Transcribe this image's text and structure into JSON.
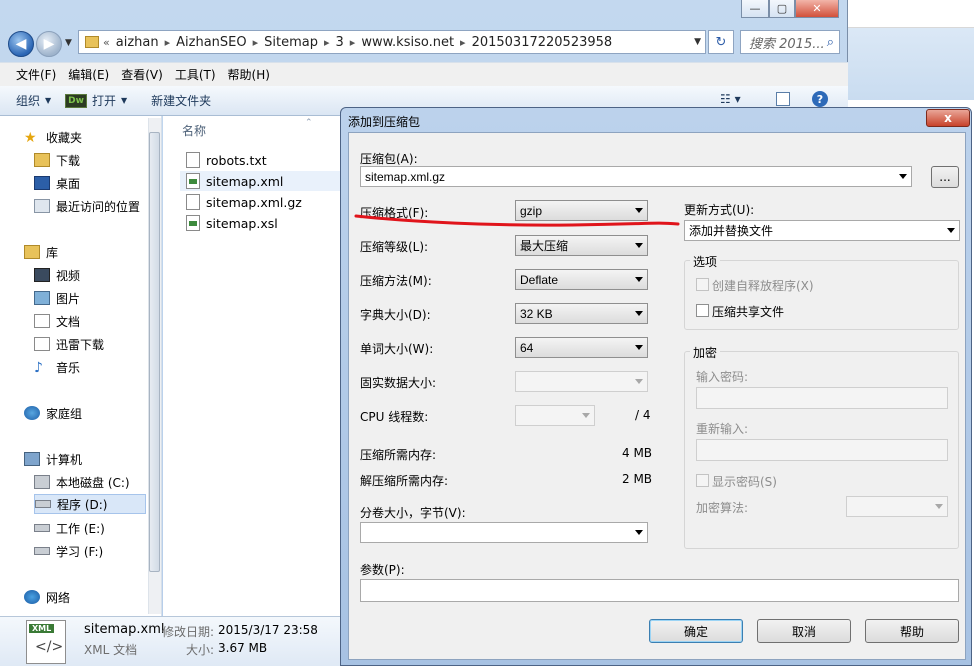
{
  "explorer": {
    "breadcrumbs": [
      "aizhan",
      "AizhanSEO",
      "Sitemap",
      "3",
      "www.ksiso.net",
      "20150317220523958"
    ],
    "search_placeholder": "搜索 2015...",
    "menu": [
      "文件(F)",
      "编辑(E)",
      "查看(V)",
      "工具(T)",
      "帮助(H)"
    ],
    "toolbar": {
      "organize": "组织",
      "open": "打开",
      "dw_badge": "Dw",
      "new_folder": "新建文件夹"
    },
    "nav": {
      "favorites": "收藏夹",
      "downloads": "下载",
      "desktop": "桌面",
      "recent": "最近访问的位置",
      "libraries": "库",
      "videos": "视频",
      "pictures": "图片",
      "documents": "文档",
      "xunlei": "迅雷下载",
      "music": "音乐",
      "homegroup": "家庭组",
      "computer": "计算机",
      "drive_c": "本地磁盘 (C:)",
      "drive_d": "程序 (D:)",
      "drive_e": "工作 (E:)",
      "drive_f": "学习 (F:)",
      "network": "网络"
    },
    "column_name": "名称",
    "files": [
      "robots.txt",
      "sitemap.xml",
      "sitemap.xml.gz",
      "sitemap.xsl"
    ],
    "status": {
      "icon_tag": "XML",
      "icon_glyph": "</>",
      "filename": "sitemap.xml",
      "modified_label": "修改日期:",
      "modified_value": "2015/3/17 23:58",
      "type": "XML 文档",
      "size_label": "大小:",
      "size_value": "3.67 MB"
    }
  },
  "dialog": {
    "title": "添加到压缩包",
    "archive_label": "压缩包(A):",
    "archive_value": "sitemap.xml.gz",
    "browse": "...",
    "format_label": "压缩格式(F):",
    "format_value": "gzip",
    "level_label": "压缩等级(L):",
    "level_value": "最大压缩",
    "method_label": "压缩方法(M):",
    "method_value": "Deflate",
    "dict_label": "字典大小(D):",
    "dict_value": "32 KB",
    "word_label": "单词大小(W):",
    "word_value": "64",
    "solid_label": "固实数据大小:",
    "cpu_label": "CPU 线程数:",
    "cpu_total": "/ 4",
    "mem_comp_label": "压缩所需内存:",
    "mem_comp_value": "4 MB",
    "mem_decomp_label": "解压缩所需内存:",
    "mem_decomp_value": "2 MB",
    "volume_label": "分卷大小，字节(V):",
    "params_label": "参数(P):",
    "update_label": "更新方式(U):",
    "update_value": "添加并替换文件",
    "options_title": "选项",
    "opt_sfx": "创建自释放程序(X)",
    "opt_shared": "压缩共享文件",
    "encrypt_title": "加密",
    "pwd_label": "输入密码:",
    "pwd_confirm_label": "重新输入:",
    "show_pwd": "显示密码(S)",
    "enc_method_label": "加密算法:",
    "ok": "确定",
    "cancel": "取消",
    "help": "帮助",
    "close_glyph": "x"
  },
  "colors": {
    "annotation_red": "#e0141b",
    "accent": "#3c7fb1"
  }
}
